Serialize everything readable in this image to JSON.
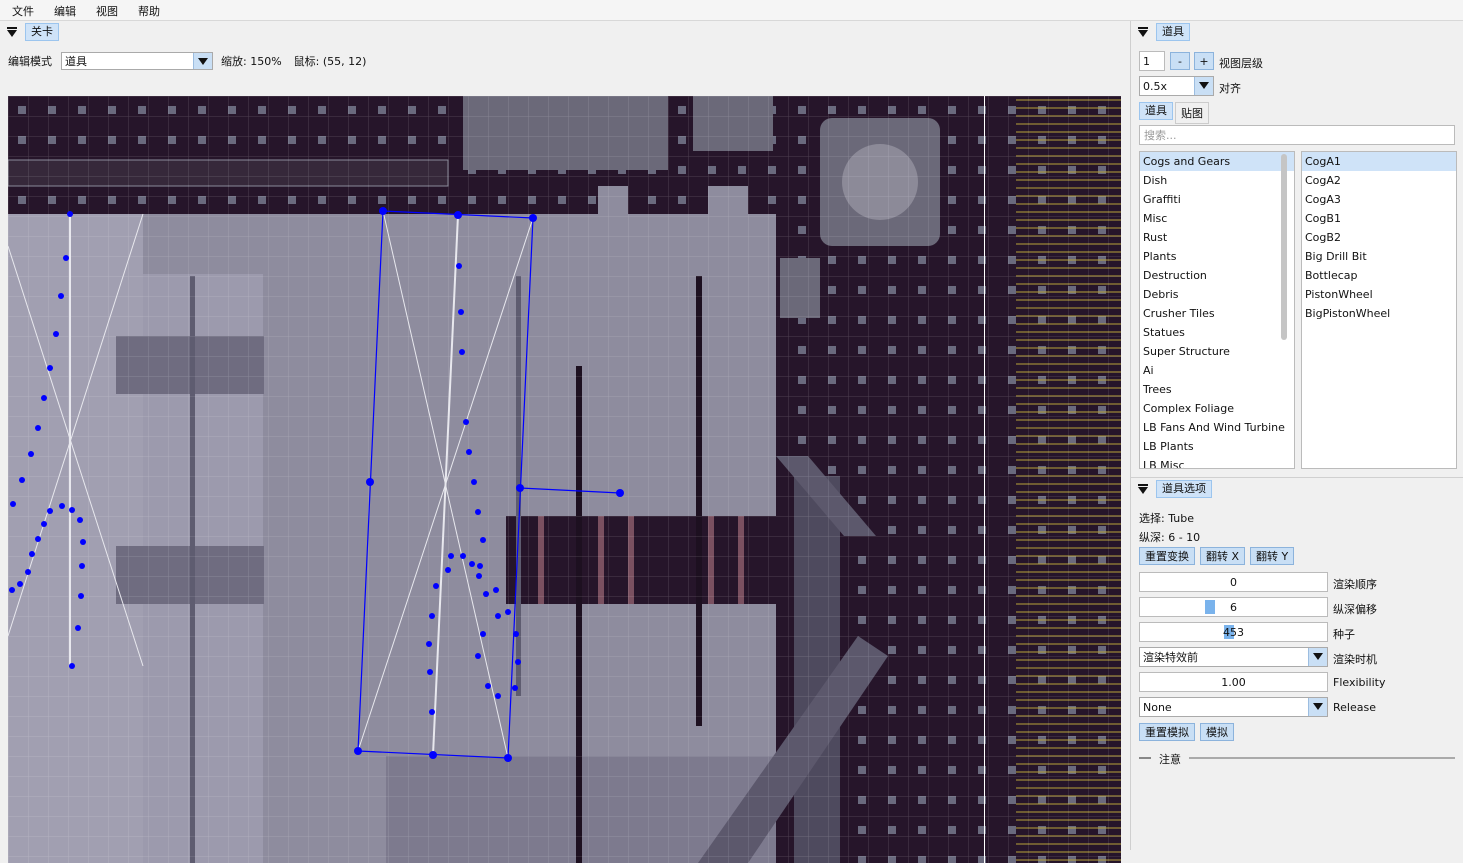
{
  "menu": [
    "文件",
    "编辑",
    "视图",
    "帮助"
  ],
  "level_panel": {
    "tab": "关卡",
    "edit_mode_label": "编辑模式",
    "edit_mode_value": "道具",
    "zoom_text": "缩放: 150%",
    "mouse_text": "鼠标: (55, 12)"
  },
  "props_panel": {
    "tab": "道具",
    "layer_value": "1",
    "minus": "-",
    "plus": "+",
    "layer_label": "视图层级",
    "snap_value": "0.5x",
    "snap_label": "对齐",
    "subtabs": [
      "道具",
      "贴图"
    ],
    "search_placeholder": "搜索...",
    "categories": [
      "Cogs and Gears",
      "Dish",
      "Graffiti",
      "Misc",
      "Rust",
      "Plants",
      "Destruction",
      "Debris",
      "Crusher Tiles",
      "Statues",
      "Super Structure",
      "Ai",
      "Trees",
      "Complex Foliage",
      "LB Fans And Wind Turbine",
      "LB Plants",
      "LB Misc"
    ],
    "selected_category": 0,
    "items": [
      "CogA1",
      "CogA2",
      "CogA3",
      "CogB1",
      "CogB2",
      "Big Drill Bit",
      "Bottlecap",
      "PistonWheel",
      "BigPistonWheel"
    ],
    "selected_item": 0
  },
  "prop_options": {
    "tab": "道具选项",
    "selection": "选择: Tube",
    "depth": "纵深: 6 - 10",
    "buttons": [
      "重置变换",
      "翻转 X",
      "翻转 Y"
    ],
    "render_order_value": "0",
    "render_order_label": "渲染顺序",
    "depth_offset_value": "6",
    "depth_offset_label": "纵深偏移",
    "depth_offset_fraction": 0.35,
    "seed_value": "453",
    "seed_label": "种子",
    "seed_fraction": 0.45,
    "render_time_value": "渲染特效前",
    "render_time_label": "渲染时机",
    "flexibility_value": "1.00",
    "flexibility_label": "Flexibility",
    "release_value": "None",
    "release_label": "Release",
    "sim_buttons": [
      "重置模拟",
      "模拟"
    ],
    "notes_label": "注意"
  },
  "colors": {
    "accent": "#cfe3f8",
    "selection_blue": "#0000ff",
    "canvas_bg": "#26152a"
  }
}
